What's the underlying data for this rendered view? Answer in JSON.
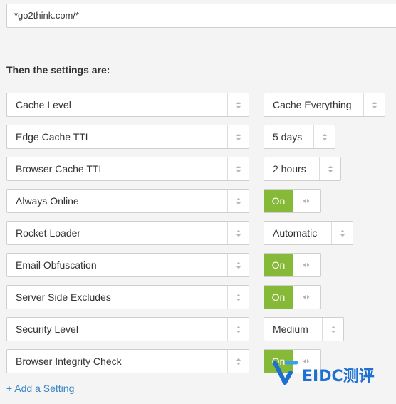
{
  "url_pattern": "*go2think.com/*",
  "section_title": "Then the settings are:",
  "settings": [
    {
      "label": "Cache Level",
      "value": "Cache Everything",
      "kind": "select"
    },
    {
      "label": "Edge Cache TTL",
      "value": "5 days",
      "kind": "select"
    },
    {
      "label": "Browser Cache TTL",
      "value": "2 hours",
      "kind": "select"
    },
    {
      "label": "Always Online",
      "value": "On",
      "kind": "toggle"
    },
    {
      "label": "Rocket Loader",
      "value": "Automatic",
      "kind": "select"
    },
    {
      "label": "Email Obfuscation",
      "value": "On",
      "kind": "toggle"
    },
    {
      "label": "Server Side Excludes",
      "value": "On",
      "kind": "toggle"
    },
    {
      "label": "Security Level",
      "value": "Medium",
      "kind": "select"
    },
    {
      "label": "Browser Integrity Check",
      "value": "On",
      "kind": "toggle"
    }
  ],
  "add_setting_label": "+ Add a Setting",
  "watermark_text": "EIDC测评",
  "colors": {
    "toggle_on": "#86b938",
    "link": "#3a87c8",
    "watermark": "#1d6fd1"
  },
  "icons": {
    "select_arrow": "updown-arrows-icon",
    "toggle_handle": "left-right-arrows-icon"
  }
}
